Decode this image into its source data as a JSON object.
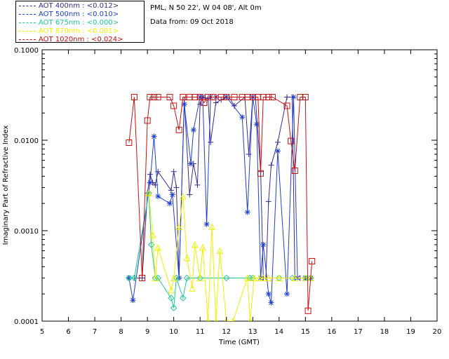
{
  "header": {
    "station": "PML, N 50 22', W 04 08', Alt 0m",
    "date_line": "Data from: 09 Oct 2018"
  },
  "legend": [
    {
      "label": "AOT  400nm : <0.012>",
      "color": "#3a2a8c"
    },
    {
      "label": "AOT  500nm : <0.010>",
      "color": "#1f3fd0"
    },
    {
      "label": "AOT  675nm : <0.000>",
      "color": "#1fc79a"
    },
    {
      "label": "AOT  870nm : <0.001>",
      "color": "#f0f000"
    },
    {
      "label": "AOT 1020nm : <0.024>",
      "color": "#c81010"
    }
  ],
  "chart_data": {
    "type": "line",
    "xlabel": "Time (GMT)",
    "ylabel": "Imaginary Part of Refractive Index",
    "xlim": [
      5,
      20
    ],
    "ylim": [
      0.0001,
      0.1
    ],
    "yscale": "log",
    "xticks": [
      "5",
      "6",
      "7",
      "8",
      "9",
      "10",
      "11",
      "12",
      "13",
      "14",
      "15",
      "16",
      "17",
      "18",
      "19",
      "20"
    ],
    "yticks": [
      {
        "value": 0.0001,
        "label": "0.0001"
      },
      {
        "value": 0.001,
        "label": "0.0010"
      },
      {
        "value": 0.01,
        "label": "0.0100"
      },
      {
        "value": 0.1,
        "label": "0.1000"
      }
    ],
    "series": [
      {
        "name": "AOT  400nm : <0.012>",
        "color": "#3a2a8c",
        "marker": "plus",
        "points": [
          [
            8.3,
            0.0003
          ],
          [
            8.5,
            0.0003
          ],
          [
            8.8,
            0.0003
          ],
          [
            9.0,
            0.0026
          ],
          [
            9.1,
            0.0042
          ],
          [
            9.2,
            0.0034
          ],
          [
            9.3,
            0.0032
          ],
          [
            9.4,
            0.0045
          ],
          [
            9.9,
            0.0028
          ],
          [
            10.0,
            0.0045
          ],
          [
            10.1,
            0.003
          ],
          [
            10.2,
            0.0003
          ],
          [
            10.4,
            0.028
          ],
          [
            10.6,
            0.0025
          ],
          [
            10.75,
            0.0055
          ],
          [
            10.9,
            0.0032
          ],
          [
            11.0,
            0.025
          ],
          [
            11.1,
            0.03
          ],
          [
            11.3,
            0.029
          ],
          [
            11.4,
            0.0095
          ],
          [
            11.6,
            0.026
          ],
          [
            11.8,
            0.028
          ],
          [
            12.0,
            0.03
          ],
          [
            12.1,
            0.03
          ],
          [
            12.3,
            0.024
          ],
          [
            12.7,
            0.03
          ],
          [
            12.85,
            0.007
          ],
          [
            13.0,
            0.03
          ],
          [
            13.1,
            0.03
          ],
          [
            13.3,
            0.0045
          ],
          [
            13.4,
            0.0003
          ],
          [
            13.5,
            0.0003
          ],
          [
            13.6,
            0.0021
          ],
          [
            13.7,
            0.0053
          ],
          [
            13.95,
            0.0095
          ],
          [
            14.3,
            0.03
          ],
          [
            14.5,
            0.03
          ],
          [
            14.6,
            0.0003
          ],
          [
            14.8,
            0.0003
          ],
          [
            15.0,
            0.0003
          ],
          [
            15.2,
            0.0003
          ]
        ]
      },
      {
        "name": "AOT  500nm : <0.010>",
        "color": "#1f3fd0",
        "marker": "asterisk",
        "points": [
          [
            8.3,
            0.0003
          ],
          [
            8.45,
            0.00017
          ],
          [
            9.1,
            0.0034
          ],
          [
            9.25,
            0.011
          ],
          [
            9.4,
            0.0024
          ],
          [
            9.85,
            0.002
          ],
          [
            9.95,
            0.0025
          ],
          [
            10.2,
            0.0003
          ],
          [
            10.4,
            0.025
          ],
          [
            10.65,
            0.0055
          ],
          [
            10.75,
            0.013
          ],
          [
            11.0,
            0.03
          ],
          [
            11.1,
            0.03
          ],
          [
            11.25,
            0.00118
          ],
          [
            11.4,
            0.03
          ],
          [
            11.6,
            0.03
          ],
          [
            12.0,
            0.03
          ],
          [
            12.6,
            0.018
          ],
          [
            12.8,
            0.0016
          ],
          [
            13.0,
            0.03
          ],
          [
            13.15,
            0.015
          ],
          [
            13.3,
            0.0003
          ],
          [
            13.4,
            0.0007
          ],
          [
            13.6,
            0.0002
          ],
          [
            13.7,
            0.00016
          ],
          [
            13.95,
            0.0076
          ],
          [
            14.3,
            0.0002
          ],
          [
            14.55,
            0.03
          ],
          [
            14.7,
            0.0003
          ],
          [
            15.0,
            0.0003
          ],
          [
            15.2,
            0.0003
          ]
        ]
      },
      {
        "name": "AOT  675nm : <0.000>",
        "color": "#1fc79a",
        "marker": "diamond",
        "points": [
          [
            8.3,
            0.0003
          ],
          [
            8.5,
            0.0003
          ],
          [
            9.05,
            0.0026
          ],
          [
            9.15,
            0.0007
          ],
          [
            9.3,
            0.0003
          ],
          [
            9.4,
            0.0003
          ],
          [
            9.9,
            0.00018
          ],
          [
            10.0,
            0.00014
          ],
          [
            10.1,
            0.0003
          ],
          [
            10.35,
            0.00018
          ],
          [
            10.5,
            0.0003
          ],
          [
            11.0,
            0.0003
          ],
          [
            12.0,
            0.0003
          ],
          [
            12.9,
            0.0003
          ],
          [
            13.0,
            0.0003
          ],
          [
            14.0,
            0.0003
          ],
          [
            14.5,
            0.0003
          ],
          [
            15.0,
            0.0003
          ],
          [
            15.2,
            0.0003
          ]
        ]
      },
      {
        "name": "AOT  870nm : <0.001>",
        "color": "#f0f000",
        "marker": "triangle",
        "points": [
          [
            9.05,
            0.0026
          ],
          [
            9.2,
            0.0009
          ],
          [
            9.3,
            0.0003
          ],
          [
            9.4,
            0.00065
          ],
          [
            9.9,
            0.00022
          ],
          [
            10.0,
            0.0003
          ],
          [
            10.2,
            0.0011
          ],
          [
            10.35,
            0.0024
          ],
          [
            10.5,
            0.0005
          ],
          [
            10.7,
            0.00023
          ],
          [
            10.8,
            0.0007
          ],
          [
            11.0,
            0.0003
          ],
          [
            11.1,
            0.00065
          ],
          [
            11.3,
            0.0001
          ],
          [
            11.45,
            0.0011
          ],
          [
            11.6,
            0.0001
          ],
          [
            11.75,
            0.0006
          ],
          [
            12.0,
            0.0001
          ],
          [
            12.25,
            0.0001
          ],
          [
            12.8,
            0.0003
          ],
          [
            12.9,
            0.0001
          ],
          [
            13.05,
            0.0003
          ],
          [
            13.25,
            0.0003
          ],
          [
            13.4,
            0.0003
          ],
          [
            13.6,
            0.0003
          ],
          [
            14.0,
            0.0003
          ],
          [
            14.6,
            0.0003
          ],
          [
            15.0,
            0.0003
          ],
          [
            15.2,
            0.0003
          ]
        ]
      },
      {
        "name": "AOT 1020nm : <0.024>",
        "color": "#c81010",
        "marker": "square",
        "points": [
          [
            8.3,
            0.0094
          ],
          [
            8.5,
            0.03
          ],
          [
            8.8,
            0.0003
          ],
          [
            9.0,
            0.0165
          ],
          [
            9.1,
            0.03
          ],
          [
            9.25,
            0.03
          ],
          [
            9.4,
            0.03
          ],
          [
            9.85,
            0.03
          ],
          [
            10.0,
            0.024
          ],
          [
            10.2,
            0.013
          ],
          [
            10.35,
            0.03
          ],
          [
            10.6,
            0.03
          ],
          [
            10.8,
            0.03
          ],
          [
            11.0,
            0.03
          ],
          [
            11.15,
            0.026
          ],
          [
            11.3,
            0.03
          ],
          [
            11.5,
            0.03
          ],
          [
            11.8,
            0.03
          ],
          [
            12.0,
            0.03
          ],
          [
            12.3,
            0.03
          ],
          [
            12.6,
            0.03
          ],
          [
            12.8,
            0.03
          ],
          [
            13.0,
            0.03
          ],
          [
            13.2,
            0.03
          ],
          [
            13.3,
            0.0043
          ],
          [
            13.4,
            0.03
          ],
          [
            13.6,
            0.03
          ],
          [
            13.75,
            0.03
          ],
          [
            14.3,
            0.024
          ],
          [
            14.45,
            0.0098
          ],
          [
            14.6,
            0.0046
          ],
          [
            14.8,
            0.03
          ],
          [
            15.0,
            0.03
          ],
          [
            15.1,
            0.00013
          ],
          [
            15.25,
            0.00046
          ]
        ]
      }
    ]
  }
}
